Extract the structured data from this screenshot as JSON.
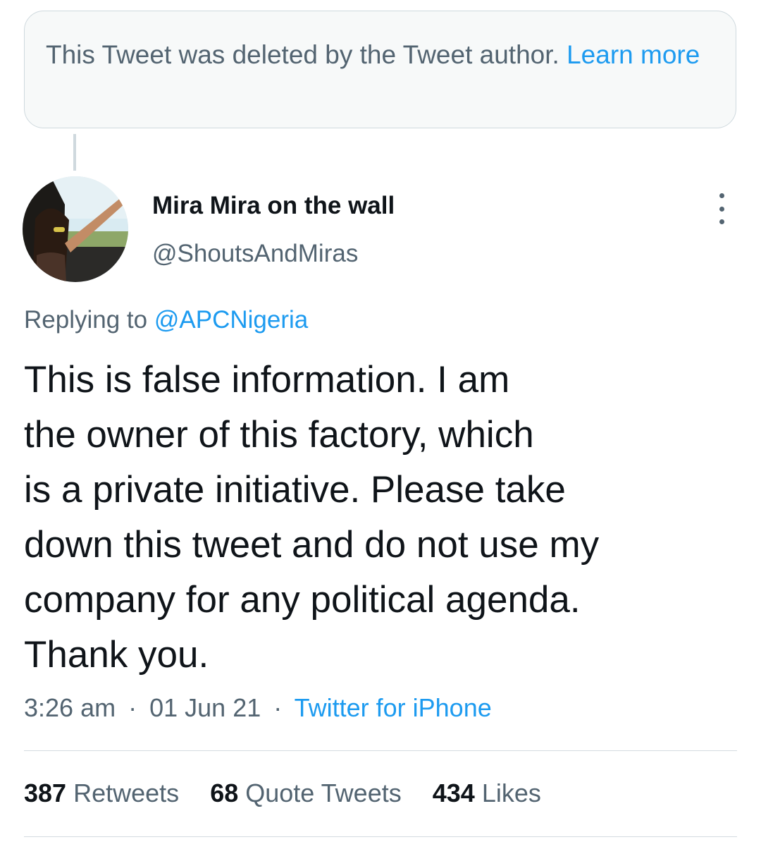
{
  "deleted_notice": {
    "text": "This Tweet was deleted by the Tweet author.",
    "link": "Learn more"
  },
  "author": {
    "display_name": "Mira Mira on the wall",
    "handle": "@ShoutsAndMiras"
  },
  "reply": {
    "prefix": "Replying to",
    "to": "@APCNigeria"
  },
  "tweet": {
    "lines": [
      "This is false information. I am",
      "the owner of this factory, which",
      "is a private initiative. Please take",
      "down this tweet and do not use my",
      "company for any political agenda.",
      "Thank you."
    ]
  },
  "meta": {
    "time": "3:26 am",
    "date": "01 Jun 21",
    "separator": "·",
    "source": "Twitter for iPhone"
  },
  "stats": {
    "retweets_count": "387",
    "retweets_label": "Retweets",
    "quotes_count": "68",
    "quotes_label": "Quote Tweets",
    "likes_count": "434",
    "likes_label": "Likes"
  },
  "icons": {
    "more": "more-vertical-icon"
  },
  "colors": {
    "link": "#1d9bf0",
    "secondary_text": "#536471",
    "primary_text": "#0f1419",
    "border": "#cfd9de",
    "notice_bg": "#f7f9f9"
  }
}
